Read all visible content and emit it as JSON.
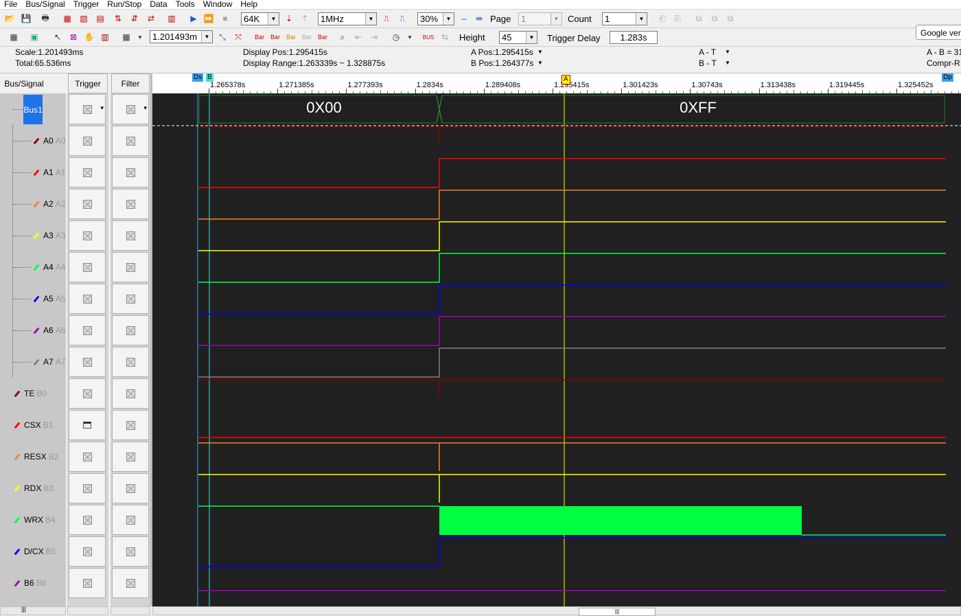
{
  "menu": [
    "File",
    "Bus/Signal",
    "Trigger",
    "Run/Stop",
    "Data",
    "Tools",
    "Window",
    "Help"
  ],
  "toolbar1": {
    "memory_depth": "64K",
    "sample_rate": "1MHz",
    "trigger_percent": "30%",
    "page_label": "Page",
    "page_value": "1",
    "count_label": "Count",
    "count_value": "1"
  },
  "toolbar2": {
    "scale_value": "1.201493m",
    "height_label": "Height",
    "height_value": "45",
    "trigger_delay_label": "Trigger Delay",
    "trigger_delay_value": "1.283s",
    "google_tab": "Google ver"
  },
  "status": {
    "scale": "Scale:1.201493ms",
    "total": "Total:65.536ms",
    "display_pos": "Display Pos:1.295415s",
    "display_range": "Display Range:1.263339s ~ 1.328875s",
    "a_pos": "A Pos:1.295415s",
    "b_pos": "B Pos:1.264377s",
    "a_t": "A - T",
    "b_t": "B - T",
    "a_b": "A - B = 31",
    "compr": "Compr-R"
  },
  "columns": {
    "bus_signal": "Bus/Signal",
    "trigger": "Trigger",
    "filter": "Filter"
  },
  "ruler_ticks": [
    "1.265378s",
    "1.271385s",
    "1.277393s",
    "1.2834s",
    "1.289408s",
    "1.295415s",
    "1.301423s",
    "1.30743s",
    "1.313438s",
    "1.319445s",
    "1.325452s"
  ],
  "cursors": {
    "ds": "Ds",
    "b": "B",
    "a": "A",
    "dp": "Dp"
  },
  "bus": {
    "name": "Bus1",
    "value_before": "0X00",
    "value_after": "0XFF"
  },
  "signals": [
    {
      "name": "A0",
      "sub": "A0",
      "color": "#8b0000"
    },
    {
      "name": "A1",
      "sub": "A1",
      "color": "#ff0000"
    },
    {
      "name": "A2",
      "sub": "A2",
      "color": "#ff7f27"
    },
    {
      "name": "A3",
      "sub": "A3",
      "color": "#ffff00"
    },
    {
      "name": "A4",
      "sub": "A4",
      "color": "#00ff40"
    },
    {
      "name": "A5",
      "sub": "A5",
      "color": "#0000ff"
    },
    {
      "name": "A6",
      "sub": "A6",
      "color": "#a000c0"
    },
    {
      "name": "A7",
      "sub": "A7",
      "color": "#808080"
    },
    {
      "name": "TE",
      "sub": "B0",
      "color": "#8b0000"
    },
    {
      "name": "CSX",
      "sub": "B1",
      "color": "#ff0000"
    },
    {
      "name": "RESX",
      "sub": "B2",
      "color": "#ff7f27"
    },
    {
      "name": "RDX",
      "sub": "B3",
      "color": "#ffff00"
    },
    {
      "name": "WRX",
      "sub": "B4",
      "color": "#00ff40"
    },
    {
      "name": "D/CX",
      "sub": "B5",
      "color": "#0000ff"
    },
    {
      "name": "B6",
      "sub": "B6",
      "color": "#a000c0"
    }
  ]
}
